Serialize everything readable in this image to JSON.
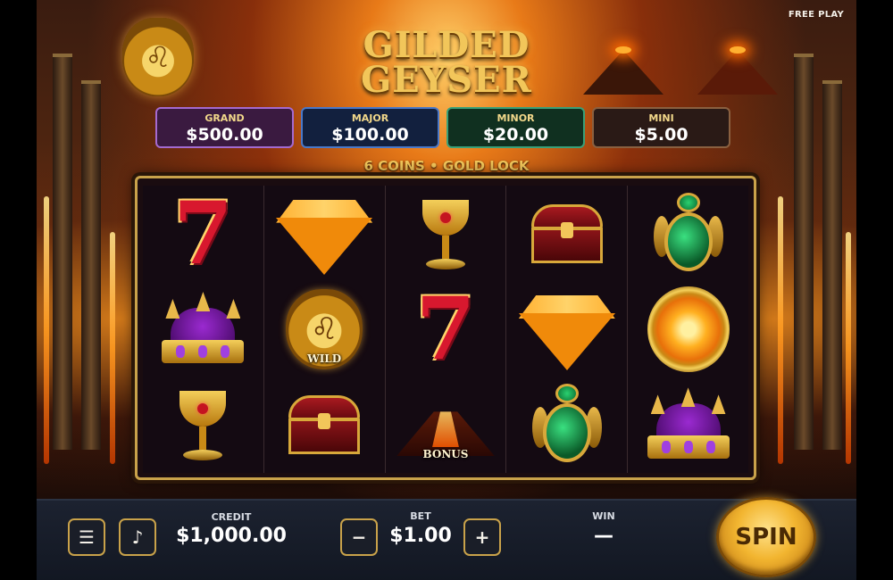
{
  "header": {
    "free_play": "FREE PLAY"
  },
  "title": {
    "line1": "GILDED",
    "line2": "GEYSER"
  },
  "jackpots": [
    {
      "label": "GRAND",
      "value": "$500.00",
      "color": "#a46ad0"
    },
    {
      "label": "MAJOR",
      "value": "$100.00",
      "color": "#4a78c8"
    },
    {
      "label": "MINOR",
      "value": "$20.00",
      "color": "#3aa078"
    },
    {
      "label": "MINI",
      "value": "$5.00",
      "color": "#8a6040"
    }
  ],
  "feature_text": "6 COINS • GOLD LOCK",
  "reels": [
    [
      "red-seven",
      "purple-crown",
      "gold-chalice"
    ],
    [
      "amber-gem",
      "lion-wild",
      "treasure-chest"
    ],
    [
      "gold-chalice",
      "red-seven",
      "volcano-bonus"
    ],
    [
      "treasure-chest",
      "amber-gem",
      "emerald-scarab"
    ],
    [
      "emerald-scarab",
      "fire-coin",
      "purple-crown"
    ]
  ],
  "symbol_labels": {
    "wild": "WILD",
    "bonus": "BONUS"
  },
  "controls": {
    "menu_icon": "menu-icon",
    "sound_icon": "music-note-icon",
    "credit_label": "CREDIT",
    "credit_value": "$1,000.00",
    "bet_label": "BET",
    "bet_minus": "−",
    "bet_plus": "+",
    "bet_value": "$1.00",
    "win_label": "WIN",
    "win_value": "—",
    "spin_label": "SPIN"
  },
  "colors": {
    "gold": "#f2c65a",
    "spin_button": "#f2b530",
    "bottom_bar": "#1c2230"
  }
}
